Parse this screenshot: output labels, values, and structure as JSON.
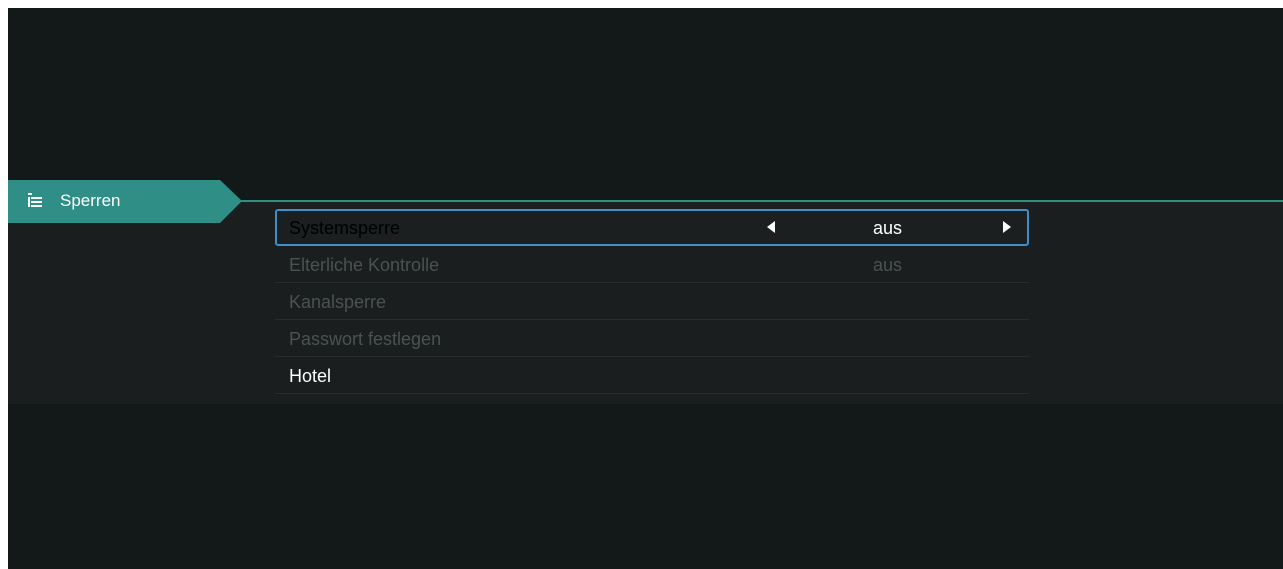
{
  "section": {
    "title": "Sperren",
    "icon": "list-menu-icon"
  },
  "menu": {
    "items": [
      {
        "label": "Systemsperre",
        "value": "aus",
        "state": "selected"
      },
      {
        "label": "Elterliche Kontrolle",
        "value": "aus",
        "state": "disabled"
      },
      {
        "label": "Kanalsperre",
        "value": "",
        "state": "disabled"
      },
      {
        "label": "Passwort festlegen",
        "value": "",
        "state": "disabled"
      },
      {
        "label": "Hotel",
        "value": "",
        "state": "enabled"
      }
    ]
  },
  "colors": {
    "accent": "#2f8e86",
    "focus_border": "#3d8ec9",
    "background": "#131919",
    "panel": "#1a1e1e",
    "text_enabled": "#ffffff",
    "text_disabled": "#4b5151"
  }
}
